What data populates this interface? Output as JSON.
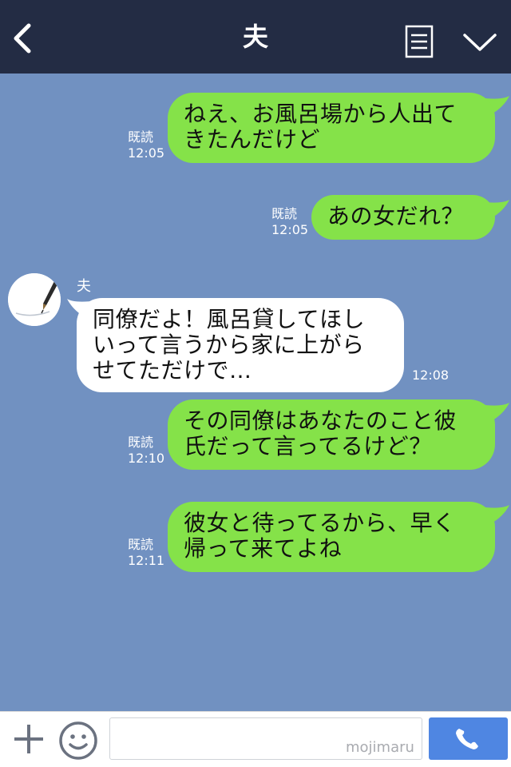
{
  "header": {
    "title": "夫",
    "back_icon": "chevron-left-icon",
    "menu_icon": "note-icon",
    "collapse_icon": "chevron-down-icon",
    "background": "#232c44"
  },
  "chat": {
    "background": "#7191c1",
    "sender_name": "夫",
    "messages": [
      {
        "dir": "out",
        "lines": [
          "ねえ、お風呂場から人出て",
          "きたんだけど"
        ],
        "read": "既読",
        "time": "12:05"
      },
      {
        "dir": "out",
        "lines": [
          "あの女だれ？"
        ],
        "read": "既読",
        "time": "12:05"
      },
      {
        "dir": "in",
        "lines": [
          "同僚だよ！風呂貸してほし",
          "いって言うから家に上がら",
          "せてただけで…"
        ],
        "time": "12:08"
      },
      {
        "dir": "out",
        "lines": [
          "その同僚はあなたのこと彼",
          "氏だって言ってるけど？"
        ],
        "read": "既読",
        "time": "12:10"
      },
      {
        "dir": "out",
        "lines": [
          "彼女と待ってるから、早く",
          "帰って来てよね"
        ],
        "read": "既読",
        "time": "12:11"
      }
    ]
  },
  "colors": {
    "outgoing_bubble": "#85e249",
    "incoming_bubble": "#ffffff",
    "call_button": "#4f86e2"
  },
  "footer": {
    "plus_icon": "plus-icon",
    "emoji_icon": "smiley-icon",
    "call_icon": "phone-icon",
    "watermark": "mojimaru"
  }
}
